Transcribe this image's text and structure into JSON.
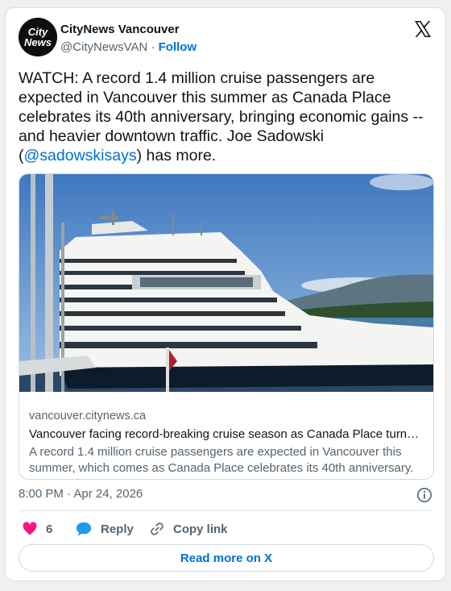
{
  "account": {
    "display_name": "CityNews Vancouver",
    "handle": "@CityNewsVAN",
    "separator": "·",
    "follow_label": "Follow",
    "avatar_logo_top": "City",
    "avatar_logo_bottom": "News"
  },
  "tweet": {
    "text_before_mention": "WATCH: A record 1.4 million cruise passengers are expected in Vancouver this summer as Canada Place celebrates its 40th anniversary, bringing economic gains -- and heavier downtown traffic. Joe Sadowski (",
    "mention": "@sadowskisays",
    "text_after_mention": ") has more.",
    "timestamp": "8:00 PM · Apr 24, 2026"
  },
  "link_card": {
    "domain": "vancouver.citynews.ca",
    "title": "Vancouver facing record-breaking cruise season as Canada Place turn…",
    "description": "A record 1.4 million cruise passengers are expected in Vancouver this summer, which comes as Canada Place celebrates its 40th anniversary."
  },
  "actions": {
    "like_count": "6",
    "reply_label": "Reply",
    "copy_link_label": "Copy link",
    "read_more_label": "Read more on X"
  },
  "colors": {
    "link_blue": "#006fd6",
    "like_pink": "#f91880",
    "reply_blue": "#1d9bf0",
    "muted_gray": "#536471"
  },
  "icons": [
    "x-logo-icon",
    "info-icon",
    "heart-icon",
    "reply-bubble-icon",
    "link-icon"
  ]
}
